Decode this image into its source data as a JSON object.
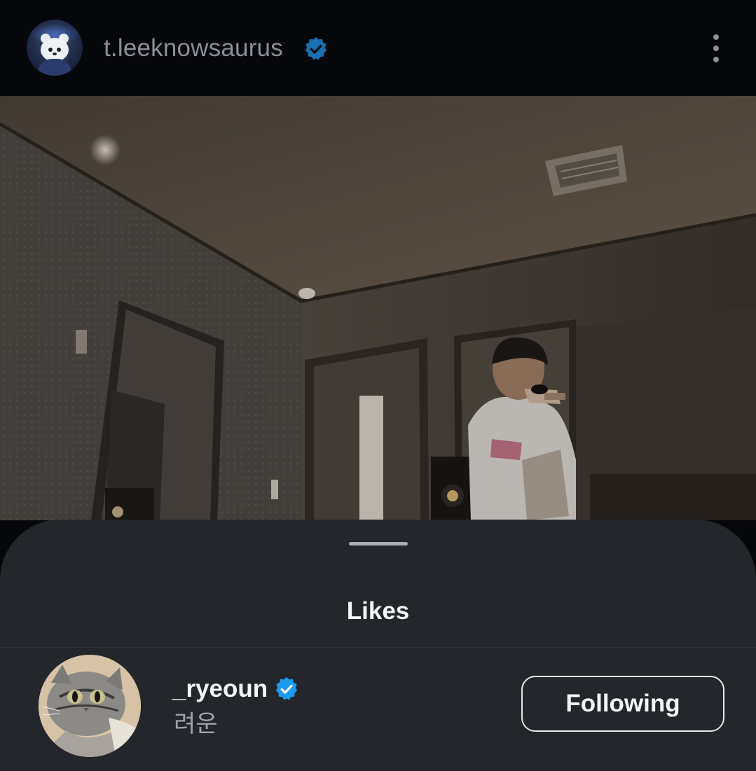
{
  "post": {
    "username": "t.leeknowsaurus",
    "verified": true,
    "avatar_icon": "bear-plush-avatar",
    "menu_icon": "more-vertical-icon"
  },
  "video": {
    "scene": "practice-room-singer"
  },
  "sheet": {
    "title": "Likes",
    "rows": [
      {
        "username": "_ryeoun",
        "verified": true,
        "full_name": "려운",
        "avatar_icon": "cat-avatar",
        "button_label": "Following"
      }
    ]
  },
  "colors": {
    "background": "#06070a",
    "sheet": "#23262b",
    "verified_blue": "#1d9bf0",
    "muted_text": "#8a8f98"
  }
}
